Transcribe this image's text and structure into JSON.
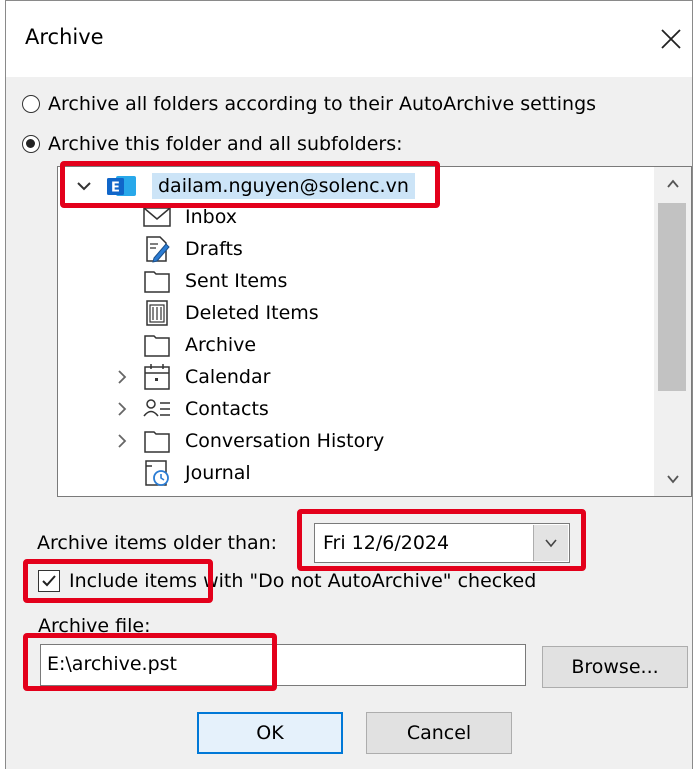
{
  "dialog": {
    "title": "Archive",
    "close_glyph": "✕"
  },
  "options": {
    "archive_all_label": "Archive all folders according to their AutoArchive settings",
    "archive_this_label": "Archive this folder and all subfolders:",
    "selected": "archive_this"
  },
  "tree": {
    "account": {
      "label": "dailam.nguyen@solenc.vn",
      "icon": "exchange-account-icon",
      "expanded": true
    },
    "items": [
      {
        "label": "Inbox",
        "icon": "inbox-icon",
        "expandable": false
      },
      {
        "label": "Drafts",
        "icon": "drafts-icon",
        "expandable": false
      },
      {
        "label": "Sent Items",
        "icon": "folder-icon",
        "expandable": false
      },
      {
        "label": "Deleted Items",
        "icon": "trash-icon",
        "expandable": false
      },
      {
        "label": "Archive",
        "icon": "folder-icon",
        "expandable": false
      },
      {
        "label": "Calendar",
        "icon": "calendar-icon",
        "expandable": true
      },
      {
        "label": "Contacts",
        "icon": "contacts-icon",
        "expandable": true
      },
      {
        "label": "Conversation History",
        "icon": "folder-icon",
        "expandable": true
      },
      {
        "label": "Journal",
        "icon": "journal-icon",
        "expandable": false
      }
    ]
  },
  "older_than": {
    "label": "Archive items older than:",
    "value": "Fri 12/6/2024"
  },
  "include_items": {
    "label": "Include items with \"Do not AutoArchive\" checked",
    "checked": true
  },
  "archive_file": {
    "label": "Archive file:",
    "value": "E:\\archive.pst",
    "browse_label": "Browse..."
  },
  "buttons": {
    "ok_label": "OK",
    "cancel_label": "Cancel"
  },
  "colors": {
    "highlight": "#e3001b",
    "exchange_blue": "#1066c9",
    "accent": "#0078d7",
    "dialog_bg": "#f0f0f0"
  }
}
